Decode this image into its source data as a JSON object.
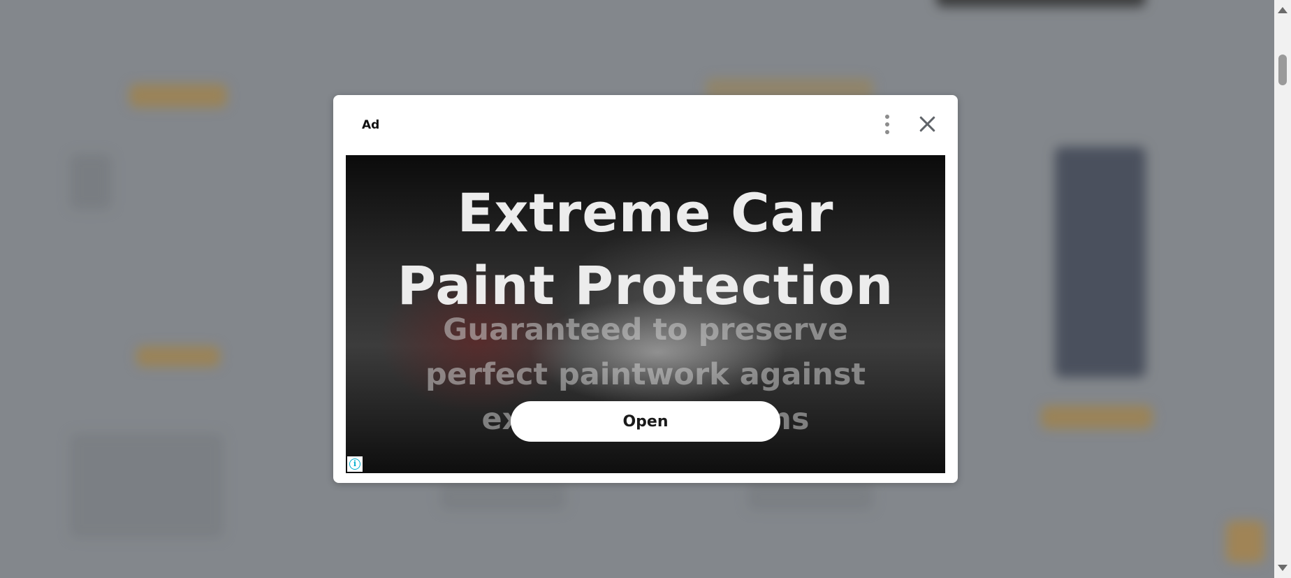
{
  "ad": {
    "label": "Ad",
    "headline_line1": "Extreme Car",
    "headline_line2": "Paint Protection",
    "subline_line1": "Guaranteed to preserve",
    "subline_line2": "perfect paintwork against",
    "subline_line3": "extreme conditions",
    "cta_label": "Open",
    "info_icon": "i"
  },
  "icons": {
    "menu": "more-vert-icon",
    "close": "close-icon",
    "info": "info-icon"
  },
  "colors": {
    "overlay": "#858a8f",
    "modal": "#ffffff",
    "info_accent": "#00aecd"
  }
}
